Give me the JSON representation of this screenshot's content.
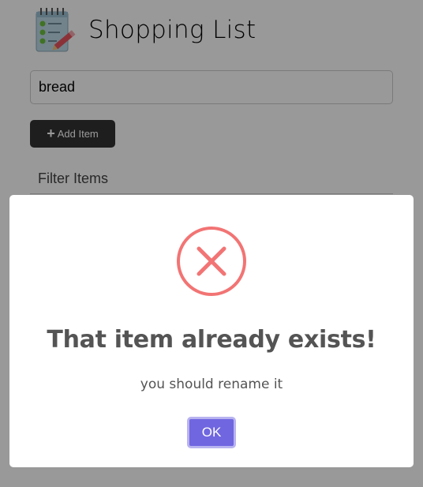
{
  "app": {
    "title": "Shopping List",
    "item_input": {
      "value": "bread"
    },
    "add_button": {
      "label": "Add Item"
    },
    "filter_input": {
      "placeholder": "Filter Items"
    }
  },
  "modal": {
    "icon": "error-x-icon",
    "title": "That item already exists!",
    "text": "you should rename it",
    "ok_label": "OK"
  },
  "colors": {
    "error": "#f27474",
    "confirm": "#7066e0",
    "button_dark": "#333333",
    "overlay": "rgba(0,0,0,0.4)"
  }
}
